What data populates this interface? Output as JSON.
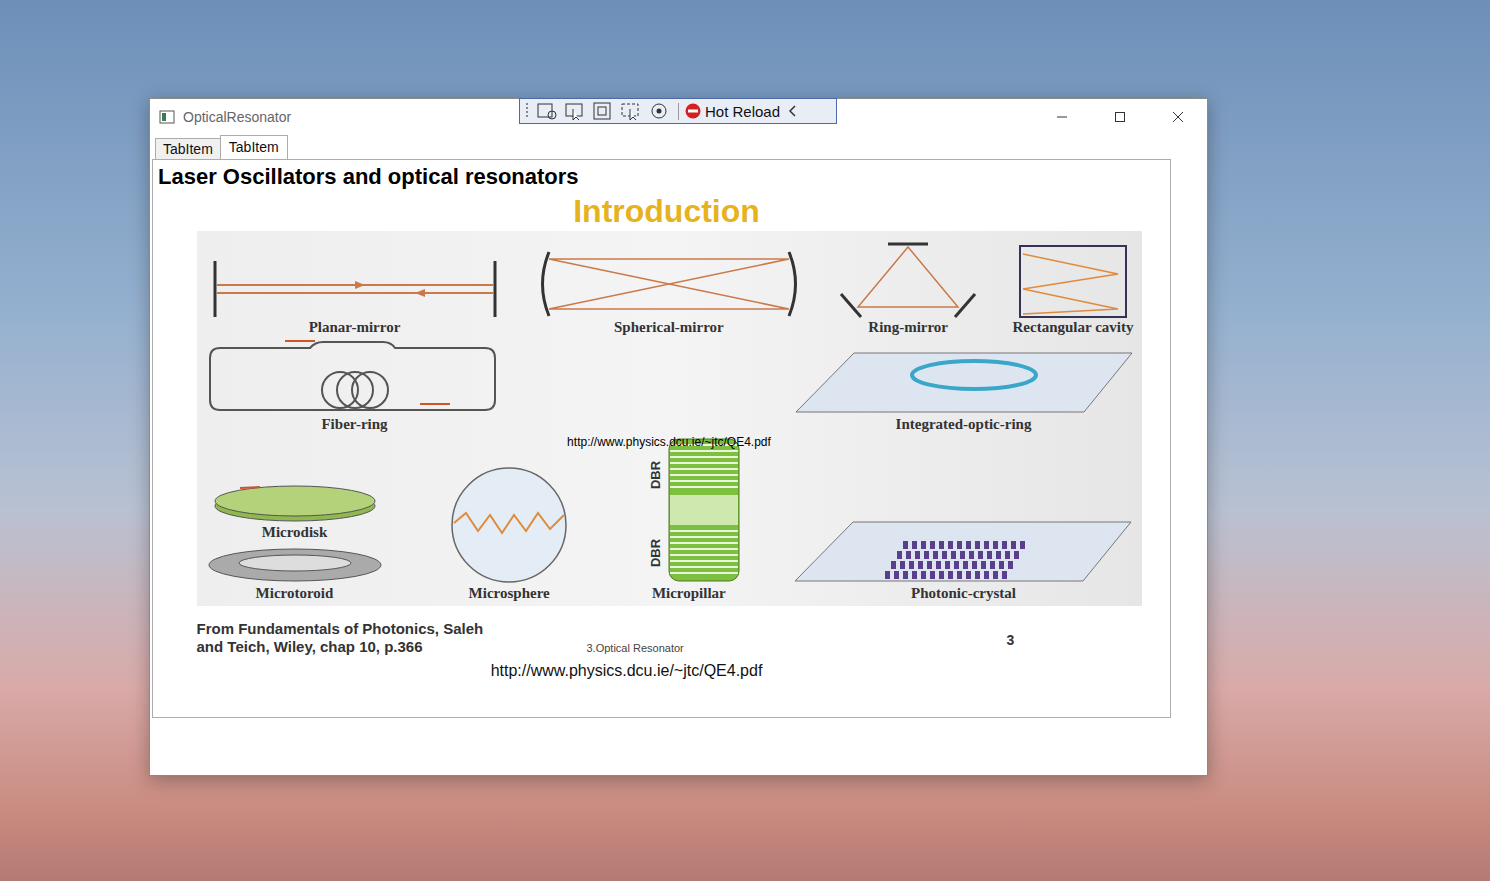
{
  "window": {
    "title": "OpticalResonator"
  },
  "debug_toolbar": {
    "label": "Hot Reload"
  },
  "tabs": [
    {
      "label": "TabItem",
      "selected": false
    },
    {
      "label": "TabItem",
      "selected": true
    }
  ],
  "heading": "Laser Oscillators and optical resonators",
  "slide": {
    "title": "Introduction",
    "figure": {
      "rows": [
        {
          "cells": [
            {
              "items": [
                {
                  "label": "Planar-mirror",
                  "kind": "planar"
                }
              ]
            },
            {
              "items": [
                {
                  "label": "Spherical-mirror",
                  "kind": "spherical"
                }
              ]
            },
            {
              "items": [
                {
                  "label": "Ring-mirror",
                  "kind": "ring"
                }
              ]
            },
            {
              "items": [
                {
                  "label": "Rectangular cavity",
                  "kind": "rect"
                }
              ]
            }
          ]
        },
        {
          "cells": [
            {
              "items": [
                {
                  "label": "Fiber-ring",
                  "kind": "fiber"
                }
              ]
            },
            {
              "items": [
                {
                  "label": "Integrated-optic-ring",
                  "kind": "integrated"
                }
              ]
            }
          ]
        },
        {
          "cells": [
            {
              "items": [
                {
                  "label": "Microdisk",
                  "kind": "microdisk"
                },
                {
                  "label": "Microtoroid",
                  "kind": "microtoroid"
                }
              ]
            },
            {
              "items": [
                {
                  "label": "Microsphere",
                  "kind": "microsphere"
                }
              ]
            },
            {
              "items": [
                {
                  "label": "Micropillar",
                  "kind": "micropillar",
                  "marks": [
                    "DBR",
                    "DBR"
                  ]
                }
              ]
            },
            {
              "items": [
                {
                  "label": "Photonic-crystal",
                  "kind": "photonic"
                }
              ]
            }
          ]
        }
      ]
    },
    "caption": [
      "From Fundamentals of Photonics, Saleh",
      "and Teich, Wiley, chap 10, p.366"
    ],
    "footer": "3.Optical Resonator",
    "page": "3"
  },
  "overlay_link": "http://www.physics.dcu.ie/~jtc/QE4.pdf",
  "link": "http://www.physics.dcu.ie/~jtc/QE4.pdf"
}
